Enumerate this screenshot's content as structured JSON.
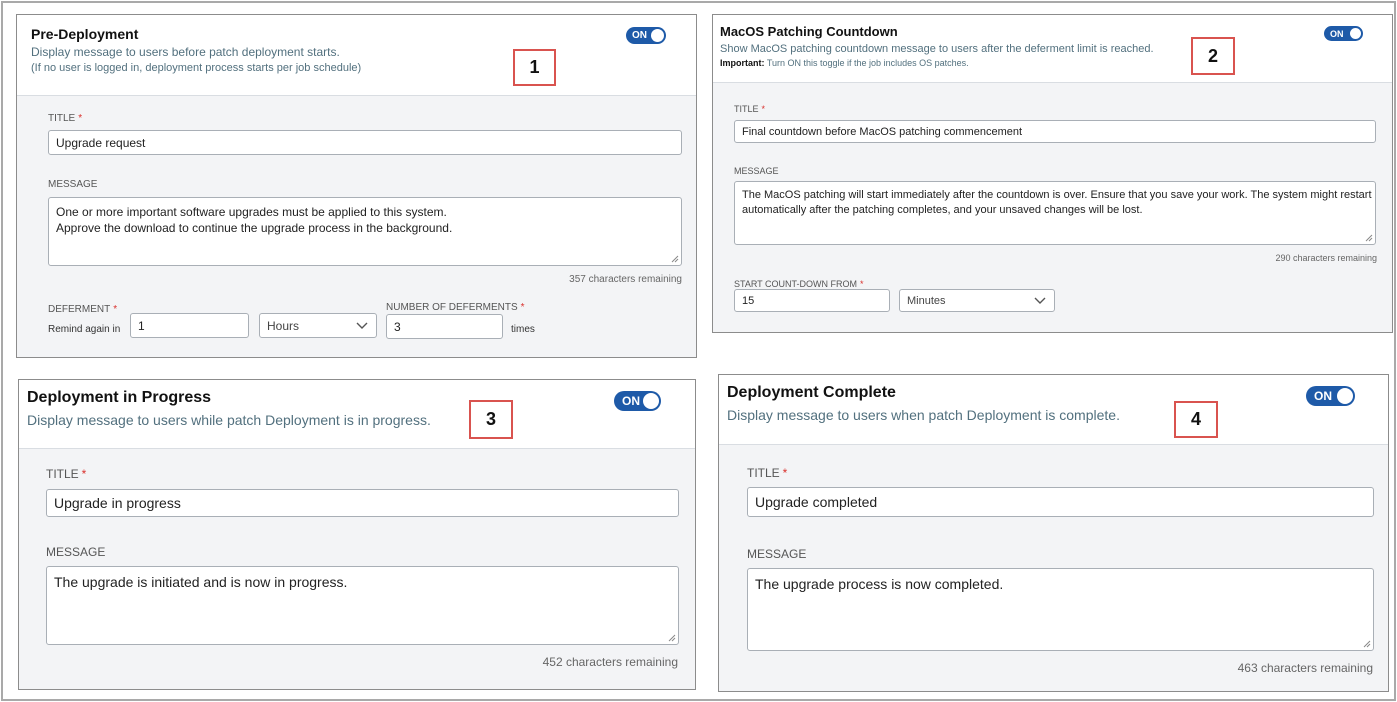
{
  "panel1": {
    "title": "Pre-Deployment",
    "desc1": "Display message to users before patch deployment starts.",
    "desc2": "(If no user is logged in, deployment process starts per job schedule)",
    "toggle": "ON",
    "badge": "1",
    "title_label": "TITLE",
    "title_value": "Upgrade request",
    "message_label": "MESSAGE",
    "message_line1": "One or more important software upgrades must be applied to this system.",
    "message_line2": "Approve the download to continue the upgrade process in the background.",
    "remaining": "357 characters remaining",
    "deferment_label": "DEFERMENT",
    "remind_label": "Remind again in",
    "remind_value": "1",
    "unit_value": "Hours",
    "num_deferments_label": "NUMBER OF DEFERMENTS",
    "num_deferments_value": "3",
    "times_label": "times"
  },
  "panel2": {
    "title": "MacOS Patching Countdown",
    "desc1": "Show MacOS patching countdown message to users after the deferment limit is reached.",
    "important_label": "Important:",
    "important_text": "Turn ON this toggle if the job includes OS patches.",
    "toggle": "ON",
    "badge": "2",
    "title_label": "TITLE",
    "title_value": "Final countdown before MacOS patching commencement",
    "message_label": "MESSAGE",
    "message_line1": "The MacOS patching will start immediately after the countdown is over. Ensure that you save your work. The system might restart",
    "message_line2": "automatically after the patching completes, and your unsaved changes will be lost.",
    "remaining": "290 characters remaining",
    "countdown_label": "START COUNT-DOWN FROM",
    "countdown_value": "15",
    "unit_value": "Minutes"
  },
  "panel3": {
    "title": "Deployment in Progress",
    "desc1": "Display message to users while patch Deployment is in progress.",
    "toggle": "ON",
    "badge": "3",
    "title_label": "TITLE",
    "title_value": "Upgrade in progress",
    "message_label": "MESSAGE",
    "message_line1": "The upgrade is initiated and is now in progress.",
    "remaining": "452 characters remaining"
  },
  "panel4": {
    "title": "Deployment Complete",
    "desc1": "Display message to users when patch Deployment is complete.",
    "toggle": "ON",
    "badge": "4",
    "title_label": "TITLE",
    "title_value": "Upgrade completed",
    "message_label": "MESSAGE",
    "message_line1": "The upgrade process is now completed.",
    "remaining": "463 characters remaining"
  },
  "colors": {
    "toggle_on": "#1e5aa8",
    "badge_border": "#d9534f",
    "required_asterisk": "#d9302c",
    "description_text": "#52707e"
  }
}
